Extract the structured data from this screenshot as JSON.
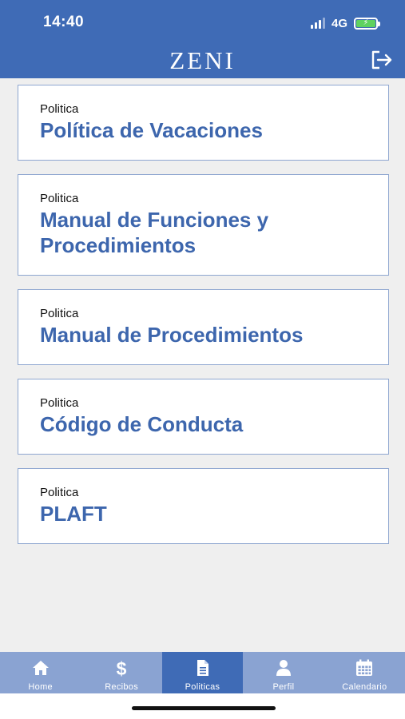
{
  "status": {
    "time": "14:40",
    "network": "4G"
  },
  "header": {
    "logo": "ZENI"
  },
  "policies": [
    {
      "kind": "Politica",
      "title": "Política de Vacaciones"
    },
    {
      "kind": "Politica",
      "title": "Manual de Funciones y Procedimientos"
    },
    {
      "kind": "Politica",
      "title": "Manual de Procedimientos"
    },
    {
      "kind": "Politica",
      "title": "Código de Conducta"
    },
    {
      "kind": "Politica",
      "title": "PLAFT"
    }
  ],
  "nav": [
    {
      "label": "Home",
      "icon": "home-icon"
    },
    {
      "label": "Recibos",
      "icon": "dollar-icon"
    },
    {
      "label": "Politicas",
      "icon": "document-icon",
      "active": true
    },
    {
      "label": "Perfil",
      "icon": "user-icon"
    },
    {
      "label": "Calendario",
      "icon": "calendar-icon"
    }
  ],
  "colors": {
    "primary": "#3f6bb6",
    "nav_bg": "#8aa3d2",
    "title": "#3d66ad"
  }
}
